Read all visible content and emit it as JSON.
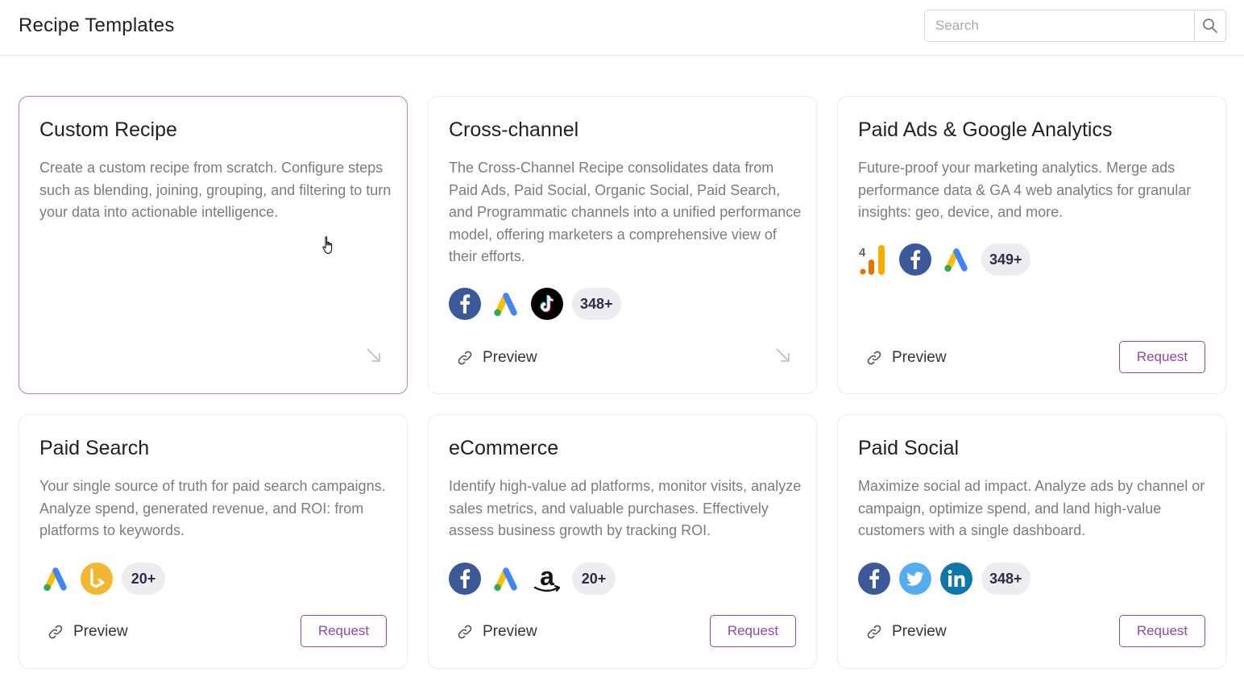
{
  "header": {
    "title": "Recipe Templates",
    "search_placeholder": "Search"
  },
  "cards": [
    {
      "title": "Custom Recipe",
      "description": "Create a custom recipe from scratch. Configure steps such as blending, joining, grouping, and filtering to turn your data into actionable intelligence.",
      "icons": [],
      "count": "",
      "preview": "",
      "request": ""
    },
    {
      "title": "Cross-channel",
      "description": "The Cross-Channel Recipe consolidates data from Paid Ads, Paid Social, Organic Social, Paid Search, and Programmatic channels into a unified performance model, offering marketers a comprehensive view of their efforts.",
      "icons": [
        "facebook-icon",
        "google-ads-icon",
        "tiktok-icon"
      ],
      "count": "348+",
      "preview": "Preview",
      "request": ""
    },
    {
      "title": "Paid Ads & Google Analytics",
      "description": "Future-proof your marketing analytics. Merge ads performance data & GA 4 web analytics for granular insights: geo, device, and more.",
      "icons": [
        "google-analytics-4-icon",
        "facebook-icon",
        "google-ads-icon"
      ],
      "count": "349+",
      "preview": "Preview",
      "request": "Request"
    },
    {
      "title": "Paid Search",
      "description": "Your single source of truth for paid search campaigns. Analyze spend, generated revenue, and ROI: from platforms to keywords.",
      "icons": [
        "google-ads-icon",
        "bing-icon"
      ],
      "count": "20+",
      "preview": "Preview",
      "request": "Request"
    },
    {
      "title": "eCommerce",
      "description": "Identify high-value ad platforms, monitor visits, analyze sales metrics, and valuable purchases. Effectively assess business growth by tracking ROI.",
      "icons": [
        "facebook-icon",
        "google-ads-icon",
        "amazon-icon"
      ],
      "count": "20+",
      "preview": "Preview",
      "request": "Request"
    },
    {
      "title": "Paid Social",
      "description": "Maximize social ad impact. Analyze ads by channel or campaign, optimize spend, and land high-value customers with a single dashboard.",
      "icons": [
        "facebook-icon",
        "twitter-icon",
        "linkedin-icon"
      ],
      "count": "348+",
      "preview": "Preview",
      "request": "Request"
    }
  ],
  "colors": {
    "accent": "#8e4aa8",
    "selected_border": "#b57fd1",
    "facebook": "#3b5998",
    "twitter": "#55acee",
    "linkedin": "#0e76a8",
    "bing": "#f2b632"
  }
}
